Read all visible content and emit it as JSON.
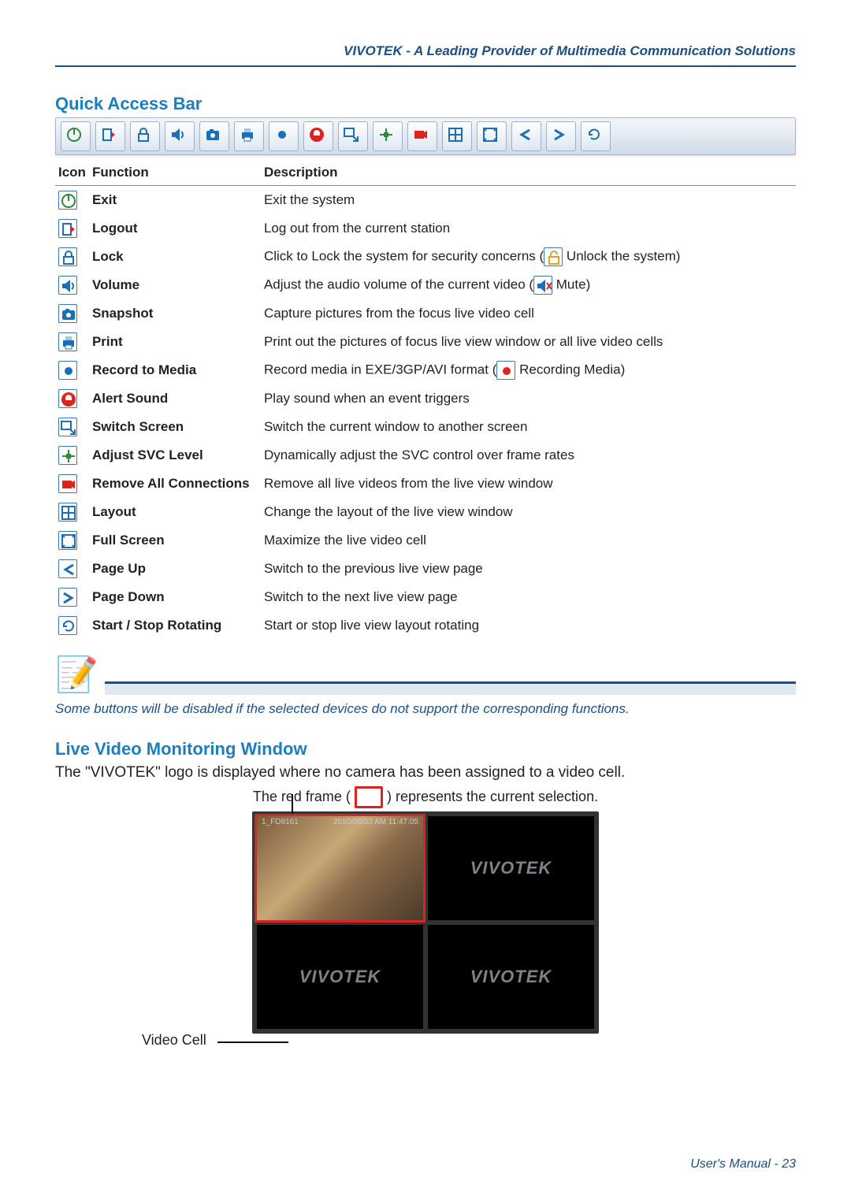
{
  "header": {
    "text": "VIVOTEK - A Leading Provider of Multimedia Communication Solutions"
  },
  "sections": {
    "quick_access_title": "Quick Access Bar",
    "live_video_title": "Live Video Monitoring Window"
  },
  "table": {
    "headers": {
      "icon": "Icon",
      "function": "Function",
      "description": "Description"
    },
    "rows": [
      {
        "icon": "exit-icon",
        "fn": "Exit",
        "desc_pre": "Exit the system",
        "inline_icon": null,
        "desc_post": ""
      },
      {
        "icon": "logout-icon",
        "fn": "Logout",
        "desc_pre": "Log out from the current station",
        "inline_icon": null,
        "desc_post": ""
      },
      {
        "icon": "lock-icon",
        "fn": "Lock",
        "desc_pre": "Click to Lock the system for security concerns (",
        "inline_icon": "unlock-icon",
        "desc_post": " Unlock the system)"
      },
      {
        "icon": "volume-icon",
        "fn": "Volume",
        "desc_pre": "Adjust the audio volume of the current video (",
        "inline_icon": "mute-icon",
        "desc_post": " Mute)"
      },
      {
        "icon": "snapshot-icon",
        "fn": "Snapshot",
        "desc_pre": "Capture pictures from the focus live video cell",
        "inline_icon": null,
        "desc_post": ""
      },
      {
        "icon": "print-icon",
        "fn": "Print",
        "desc_pre": "Print out the pictures of focus live view window or all live video cells",
        "inline_icon": null,
        "desc_post": ""
      },
      {
        "icon": "record-icon",
        "fn": "Record to Media",
        "desc_pre": "Record media in EXE/3GP/AVI format (",
        "inline_icon": "recording-icon",
        "desc_post": " Recording Media)"
      },
      {
        "icon": "alert-sound-icon",
        "fn": "Alert Sound",
        "desc_pre": "Play sound when an event triggers",
        "inline_icon": null,
        "desc_post": ""
      },
      {
        "icon": "switch-screen-icon",
        "fn": "Switch Screen",
        "desc_pre": "Switch the current window to another screen",
        "inline_icon": null,
        "desc_post": ""
      },
      {
        "icon": "adjust-svc-icon",
        "fn": "Adjust SVC Level",
        "desc_pre": "Dynamically adjust the SVC control over frame rates",
        "inline_icon": null,
        "desc_post": ""
      },
      {
        "icon": "remove-connections-icon",
        "fn": "Remove All Connections",
        "desc_pre": "Remove all live videos from the live view window",
        "inline_icon": null,
        "desc_post": ""
      },
      {
        "icon": "layout-icon",
        "fn": "Layout",
        "desc_pre": "Change the layout of the live view window",
        "inline_icon": null,
        "desc_post": ""
      },
      {
        "icon": "full-screen-icon",
        "fn": "Full Screen",
        "desc_pre": "Maximize the live video cell",
        "inline_icon": null,
        "desc_post": ""
      },
      {
        "icon": "page-up-icon",
        "fn": "Page Up",
        "desc_pre": "Switch to the previous live view page",
        "inline_icon": null,
        "desc_post": ""
      },
      {
        "icon": "page-down-icon",
        "fn": "Page Down",
        "desc_pre": "Switch to the next live view page",
        "inline_icon": null,
        "desc_post": ""
      },
      {
        "icon": "rotate-icon",
        "fn": "Start / Stop Rotating",
        "desc_pre": "Start or stop live view layout rotating",
        "inline_icon": null,
        "desc_post": ""
      }
    ]
  },
  "note": {
    "text": "Some buttons will be disabled if the selected devices do not support the corresponding functions."
  },
  "live_video": {
    "line1": "The \"VIVOTEK\" logo is displayed where no camera has been assigned to a video cell.",
    "line2_pre": "The red frame ( ",
    "line2_post": " ) represents the current selection.",
    "video_cell_label": "Video Cell",
    "logo_text": "VIVOTEK",
    "timestamp": "2010/06/03 AM 11:47:05",
    "camera_id": "1_FD8161"
  },
  "footer": {
    "text_label": "User's Manual - ",
    "page": "23"
  },
  "toolbar_icons": [
    "exit-icon",
    "logout-icon",
    "lock-icon",
    "volume-icon",
    "snapshot-icon",
    "print-icon",
    "record-icon",
    "alert-sound-icon",
    "switch-screen-icon",
    "adjust-svc-icon",
    "remove-connections-icon",
    "layout-icon",
    "full-screen-icon",
    "page-up-icon",
    "page-down-icon",
    "rotate-icon"
  ]
}
